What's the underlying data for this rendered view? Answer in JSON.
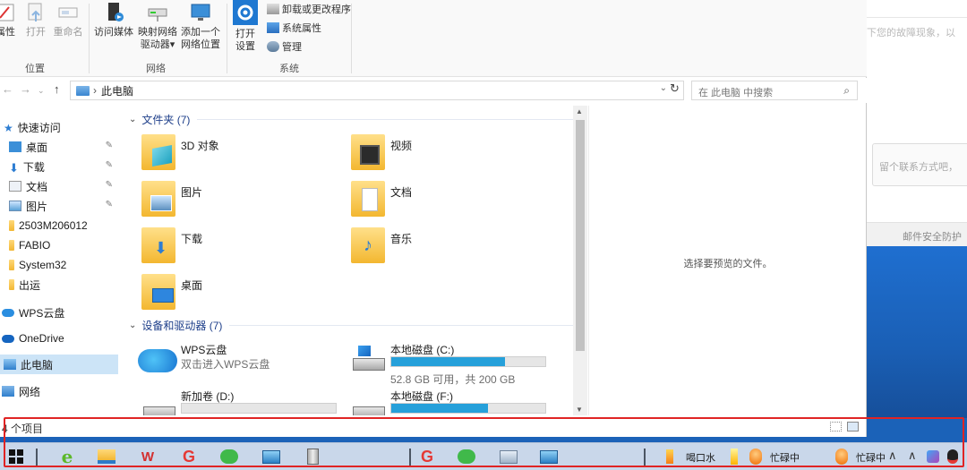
{
  "background_window": {
    "hint_text": "下您的故障现象，以",
    "contact_placeholder": "留个联系方式吧，",
    "mail_text": "邮件安全防护"
  },
  "ribbon": {
    "buttons": {
      "properties": "属性",
      "open": "打开",
      "rename": "重命名",
      "access_media": "访问媒体",
      "map_drive_1": "映射网络",
      "map_drive_2": "驱动器",
      "add_location_1": "添加一个",
      "add_location_2": "网络位置",
      "open_settings_1": "打开",
      "open_settings_2": "设置",
      "uninstall": "卸载或更改程序",
      "system_properties": "系统属性",
      "manage": "管理"
    },
    "groups": {
      "location": "位置",
      "network": "网络",
      "system": "系统"
    }
  },
  "address": {
    "path": "此电脑",
    "search_placeholder": "在 此电脑 中搜索"
  },
  "nav": {
    "quick_access": "快速访问",
    "items": [
      {
        "label": "桌面",
        "pinned": true
      },
      {
        "label": "下载",
        "pinned": true
      },
      {
        "label": "文档",
        "pinned": true
      },
      {
        "label": "图片",
        "pinned": true
      },
      {
        "label": "2503M206012",
        "pinned": false
      },
      {
        "label": "FABIO",
        "pinned": false
      },
      {
        "label": "System32",
        "pinned": false
      },
      {
        "label": "出运",
        "pinned": false
      }
    ],
    "wps_cloud": "WPS云盘",
    "onedrive": "OneDrive",
    "this_pc": "此电脑",
    "network": "网络"
  },
  "content": {
    "folders_header": "文件夹 (7)",
    "folders": [
      "3D 对象",
      "视频",
      "图片",
      "文档",
      "下载",
      "音乐",
      "桌面"
    ],
    "devices_header": "设备和驱动器 (7)",
    "devices": {
      "wps_name": "WPS云盘",
      "wps_sub": "双击进入WPS云盘",
      "c_name": "本地磁盘 (C:)",
      "c_usage": "52.8 GB 可用，共 200 GB",
      "c_used_fraction": 0.736,
      "d_name": "新加卷 (D:)",
      "d_used_fraction": 0.0,
      "f_name": "本地磁盘 (F:)",
      "f_used_fraction": 0.63
    }
  },
  "preview": {
    "message": "选择要预览的文件。"
  },
  "status": {
    "count": "4 个项目"
  },
  "taskbar": {
    "tray_text_1": "喝口水",
    "tray_text_2": "忙碌中",
    "tray_text_3": "忙碌中"
  },
  "colors": {
    "accent": "#26a0da",
    "highlight_border": "#e02424",
    "selected_bg": "#cce4f7",
    "section_header": "#1e3f8a"
  }
}
